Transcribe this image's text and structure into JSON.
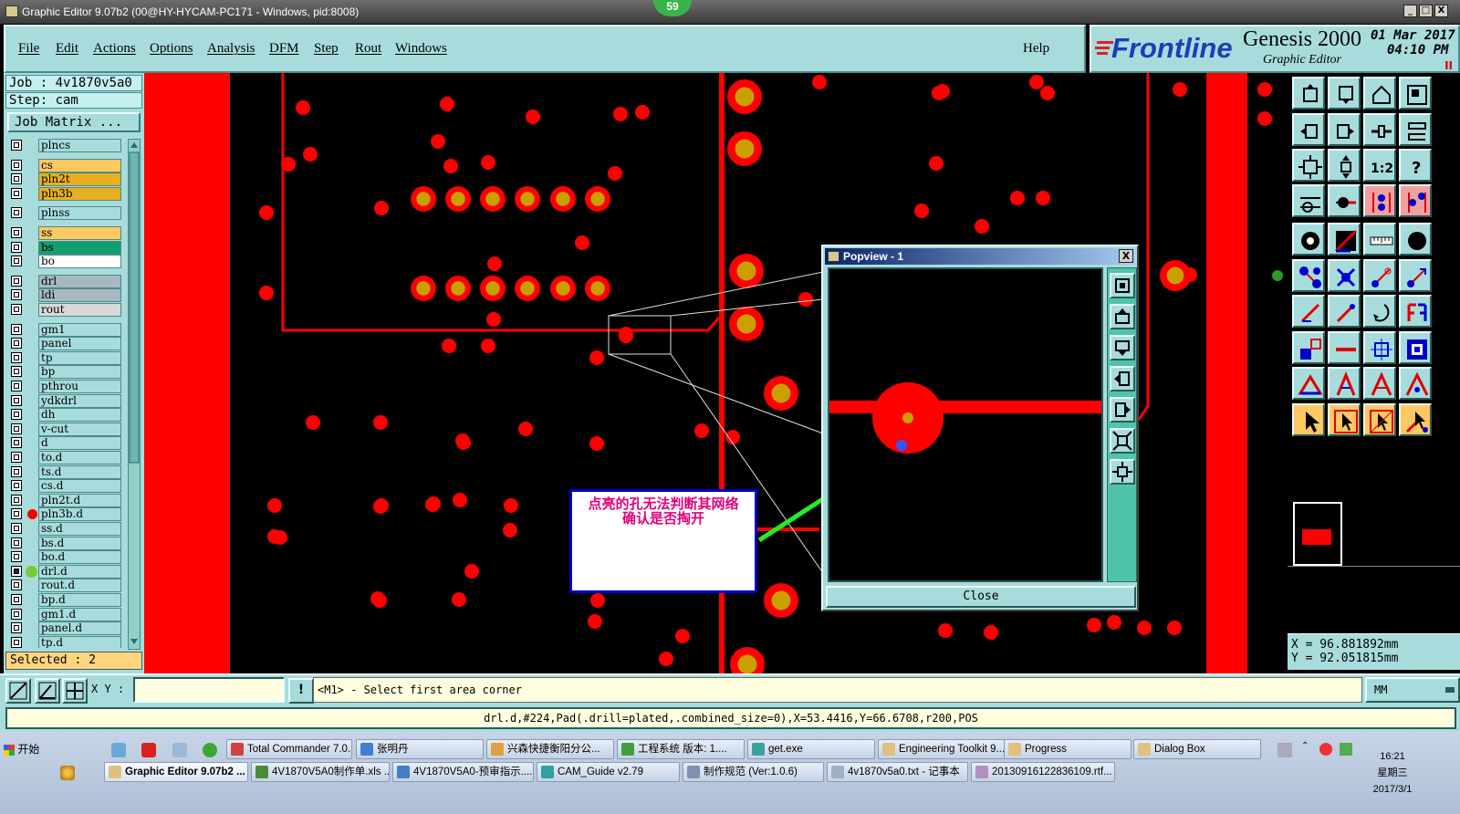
{
  "window": {
    "title": "Graphic Editor 9.07b2 (00@HY-HYCAM-PC171 - Windows, pid:8008)",
    "counter": "59",
    "min": "_",
    "max": "□",
    "close": "X"
  },
  "menu": [
    "File",
    "Edit",
    "Actions",
    "Options",
    "Analysis",
    "DFM",
    "Step",
    "Rout",
    "Windows"
  ],
  "help": "Help",
  "brand": {
    "logo": "Frontline",
    "product": "Genesis 2000",
    "subtitle": "Graphic Editor",
    "date": "01 Mar 2017",
    "time": "04:10 PM",
    "pause": "II"
  },
  "job": {
    "job": "Job : 4v1870v5a0",
    "step": "Step: cam",
    "matrix_btn": "Job Matrix ..."
  },
  "colors": {
    "board": "#ff0000",
    "pad_center": "#c8a000",
    "background": "#000000",
    "panel": "#a8dcdc",
    "arrow": "#22ee22",
    "note_text": "#e0007a"
  },
  "layers": [
    {
      "name": "plncs",
      "color": "#a8dcdc"
    },
    {
      "name": "cs",
      "color": "#ffc860"
    },
    {
      "name": "pln2t",
      "color": "#e8b020"
    },
    {
      "name": "pln3b",
      "color": "#e8b020"
    },
    {
      "name": "plnss",
      "color": "#a8dcdc"
    },
    {
      "name": "ss",
      "color": "#ffc860"
    },
    {
      "name": "bs",
      "color": "#10a070"
    },
    {
      "name": "bo",
      "color": "#ffffff"
    },
    {
      "name": "drl",
      "color": "#a8b8c0"
    },
    {
      "name": "ldi",
      "color": "#a8b8c0"
    },
    {
      "name": "rout",
      "color": "#d8d8d8"
    },
    {
      "name": "gm1",
      "color": "#a8dcdc"
    },
    {
      "name": "panel",
      "color": "#a8dcdc"
    },
    {
      "name": "tp",
      "color": "#a8dcdc"
    },
    {
      "name": "bp",
      "color": "#a8dcdc"
    },
    {
      "name": "pthrou",
      "color": "#a8dcdc"
    },
    {
      "name": "ydkdrl",
      "color": "#a8dcdc"
    },
    {
      "name": "dh",
      "color": "#a8dcdc"
    },
    {
      "name": "v-cut",
      "color": "#a8dcdc"
    },
    {
      "name": "d",
      "color": "#a8dcdc"
    },
    {
      "name": "to.d",
      "color": "#a8dcdc"
    },
    {
      "name": "ts.d",
      "color": "#a8dcdc"
    },
    {
      "name": "cs.d",
      "color": "#a8dcdc"
    },
    {
      "name": "pln2t.d",
      "color": "#a8dcdc"
    },
    {
      "name": "pln3b.d",
      "color": "#a8dcdc"
    },
    {
      "name": "ss.d",
      "color": "#a8dcdc"
    },
    {
      "name": "bs.d",
      "color": "#a8dcdc"
    },
    {
      "name": "bo.d",
      "color": "#a8dcdc"
    },
    {
      "name": "drl.d",
      "color": "#a8dcdc"
    },
    {
      "name": "rout.d",
      "color": "#a8dcdc"
    },
    {
      "name": "bp.d",
      "color": "#a8dcdc"
    },
    {
      "name": "gm1.d",
      "color": "#a8dcdc"
    },
    {
      "name": "panel.d",
      "color": "#a8dcdc"
    },
    {
      "name": "tp.d",
      "color": "#a8dcdc"
    }
  ],
  "selected": "Selected : 2",
  "popview": {
    "title": "Popview - 1",
    "close_x": "X",
    "close": "Close"
  },
  "note": {
    "line1": "点亮的孔无法判断其网络",
    "line2": "确认是否掏开"
  },
  "coords": {
    "x": "X  = 96.881892mm",
    "y": "Y  = 92.051815mm"
  },
  "cmd": {
    "xy_label": "X Y :",
    "xy_value": "",
    "bang": "!",
    "prompt": "<M1> - Select first area corner",
    "units": "MM"
  },
  "status": "drl.d,#224,Pad(.drill=plated,.combined_size=0),X=53.4416,Y=66.6708,r200,POS",
  "taskbar": {
    "start": "开始",
    "row1": [
      "Total Commander 7.0...",
      "张明丹",
      "兴森快捷衡阳分公...",
      "工程系统  版本: 1....",
      "get.exe",
      "Engineering Toolkit 9....",
      "Progress",
      "Dialog Box"
    ],
    "row2": [
      "Graphic Editor 9.07b2 ...",
      "4V1870V5A0制作单.xls ...",
      "4V1870V5A0-预审指示....",
      "CAM_Guide v2.79",
      "制作规范 (Ver:1.0.6)",
      "4v1870v5a0.txt - 记事本",
      "20130916122836109.rtf..."
    ],
    "time": "16:21",
    "weekday": "星期三",
    "date": "2017/3/1"
  }
}
